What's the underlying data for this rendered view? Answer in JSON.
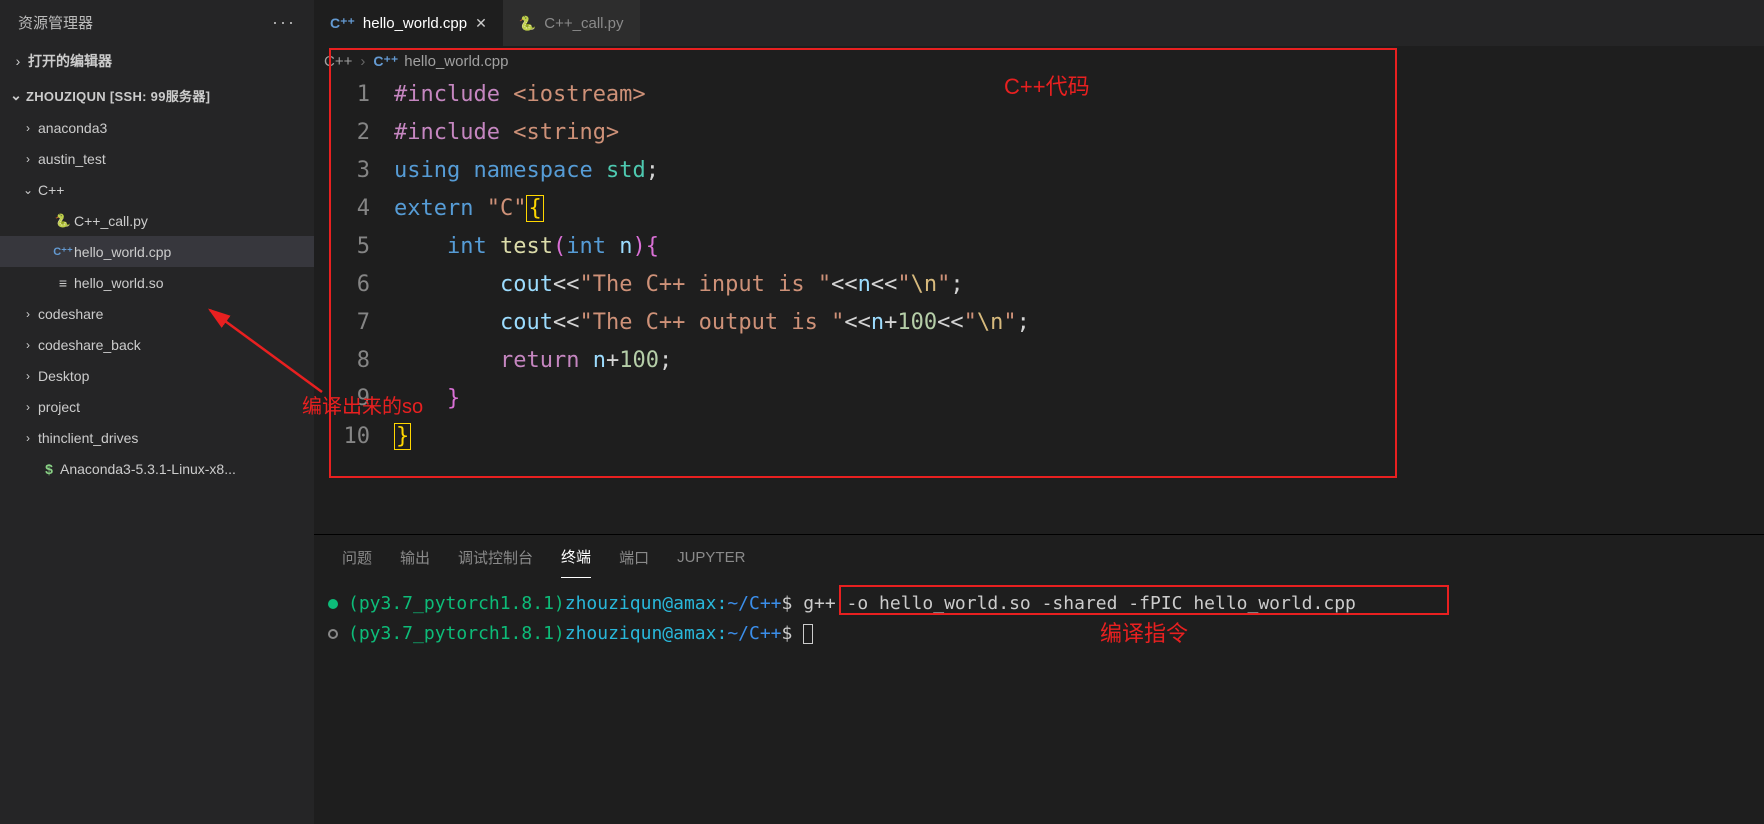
{
  "sidebar": {
    "title": "资源管理器",
    "opened_editors_label": "打开的编辑器",
    "workspace_name": "ZHOUZIQUN [SSH: 99服务器]",
    "tree": [
      {
        "type": "folder",
        "name": "anaconda3",
        "expanded": false,
        "depth": 0
      },
      {
        "type": "folder",
        "name": "austin_test",
        "expanded": false,
        "depth": 0
      },
      {
        "type": "folder",
        "name": "C++",
        "expanded": true,
        "depth": 0
      },
      {
        "type": "py",
        "name": "C++_call.py",
        "depth": 1
      },
      {
        "type": "cpp",
        "name": "hello_world.cpp",
        "depth": 1,
        "active": true
      },
      {
        "type": "file",
        "name": "hello_world.so",
        "depth": 1
      },
      {
        "type": "folder",
        "name": "codeshare",
        "expanded": false,
        "depth": 0
      },
      {
        "type": "folder",
        "name": "codeshare_back",
        "expanded": false,
        "depth": 0
      },
      {
        "type": "folder",
        "name": "Desktop",
        "expanded": false,
        "depth": 0
      },
      {
        "type": "folder",
        "name": "project",
        "expanded": false,
        "depth": 0
      },
      {
        "type": "folder",
        "name": "thinclient_drives",
        "expanded": false,
        "depth": 0
      },
      {
        "type": "sh",
        "name": "Anaconda3-5.3.1-Linux-x8...",
        "depth": 0
      }
    ]
  },
  "tabs": [
    {
      "icon": "cpp",
      "label": "hello_world.cpp",
      "active": true,
      "closeable": true
    },
    {
      "icon": "py",
      "label": "C++_call.py",
      "active": false,
      "closeable": false
    }
  ],
  "breadcrumb": {
    "parts": [
      "C++",
      "hello_world.cpp"
    ],
    "file_icon": "cpp"
  },
  "code_lines": 10,
  "code": [
    [
      {
        "t": "pre",
        "v": "#include"
      },
      {
        "t": "punc",
        "v": " "
      },
      {
        "t": "str",
        "v": "<iostream>"
      }
    ],
    [
      {
        "t": "pre",
        "v": "#include"
      },
      {
        "t": "punc",
        "v": " "
      },
      {
        "t": "str",
        "v": "<string>"
      }
    ],
    [
      {
        "t": "kw",
        "v": "using"
      },
      {
        "t": "punc",
        "v": " "
      },
      {
        "t": "kw",
        "v": "namespace"
      },
      {
        "t": "punc",
        "v": " "
      },
      {
        "t": "ns",
        "v": "std"
      },
      {
        "t": "punc",
        "v": ";"
      }
    ],
    [
      {
        "t": "kw",
        "v": "extern"
      },
      {
        "t": "punc",
        "v": " "
      },
      {
        "t": "str",
        "v": "\"C\""
      },
      {
        "t": "brace-y",
        "v": "{",
        "cursorwrap": true
      }
    ],
    [
      {
        "t": "punc",
        "v": "    "
      },
      {
        "t": "type",
        "v": "int"
      },
      {
        "t": "punc",
        "v": " "
      },
      {
        "t": "fn",
        "v": "test"
      },
      {
        "t": "brace-p",
        "v": "("
      },
      {
        "t": "type",
        "v": "int"
      },
      {
        "t": "punc",
        "v": " "
      },
      {
        "t": "var",
        "v": "n"
      },
      {
        "t": "brace-p",
        "v": ")"
      },
      {
        "t": "brace-p",
        "v": "{"
      }
    ],
    [
      {
        "t": "punc",
        "v": "        "
      },
      {
        "t": "var",
        "v": "cout"
      },
      {
        "t": "op",
        "v": "<<"
      },
      {
        "t": "str",
        "v": "\"The C++ input is \""
      },
      {
        "t": "op",
        "v": "<<"
      },
      {
        "t": "var",
        "v": "n"
      },
      {
        "t": "op",
        "v": "<<"
      },
      {
        "t": "str",
        "v": "\""
      },
      {
        "t": "esc",
        "v": "\\n"
      },
      {
        "t": "str",
        "v": "\""
      },
      {
        "t": "punc",
        "v": ";"
      }
    ],
    [
      {
        "t": "punc",
        "v": "        "
      },
      {
        "t": "var",
        "v": "cout"
      },
      {
        "t": "op",
        "v": "<<"
      },
      {
        "t": "str",
        "v": "\"The C++ output is \""
      },
      {
        "t": "op",
        "v": "<<"
      },
      {
        "t": "var",
        "v": "n"
      },
      {
        "t": "op",
        "v": "+"
      },
      {
        "t": "num",
        "v": "100"
      },
      {
        "t": "op",
        "v": "<<"
      },
      {
        "t": "str",
        "v": "\""
      },
      {
        "t": "esc",
        "v": "\\n"
      },
      {
        "t": "str",
        "v": "\""
      },
      {
        "t": "punc",
        "v": ";"
      }
    ],
    [
      {
        "t": "punc",
        "v": "        "
      },
      {
        "t": "pre",
        "v": "return"
      },
      {
        "t": "punc",
        "v": " "
      },
      {
        "t": "var",
        "v": "n"
      },
      {
        "t": "op",
        "v": "+"
      },
      {
        "t": "num",
        "v": "100"
      },
      {
        "t": "punc",
        "v": ";"
      }
    ],
    [
      {
        "t": "punc",
        "v": "    "
      },
      {
        "t": "brace-p",
        "v": "}"
      }
    ],
    [
      {
        "t": "brace-y",
        "v": "}",
        "cursorwrap": true
      }
    ]
  ],
  "panel": {
    "tabs": [
      "问题",
      "输出",
      "调试控制台",
      "终端",
      "端口",
      "JUPYTER"
    ],
    "active": 3
  },
  "terminal_lines": [
    {
      "dot": "solid",
      "env": "(py3.7_pytorch1.8.1)",
      "user": "zhouziqun@amax",
      "sep": ":",
      "path": "~/C++",
      "prompt": "$",
      "cmd": "g++ -o hello_world.so -shared -fPIC hello_world.cpp"
    },
    {
      "dot": "hollow",
      "env": "(py3.7_pytorch1.8.1)",
      "user": "zhouziqun@amax",
      "sep": ":",
      "path": "~/C++",
      "prompt": "$",
      "cmd": "",
      "cursor": true
    }
  ],
  "annotations": {
    "code_label": "C++代码",
    "so_label": "编译出来的so",
    "cmd_label": "编译指令"
  }
}
